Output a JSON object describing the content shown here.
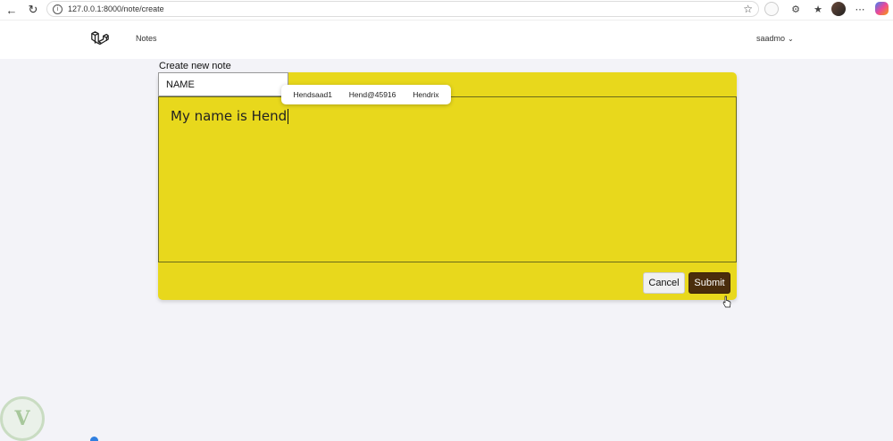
{
  "browser": {
    "url": "127.0.0.1:8000/note/create",
    "back_icon": "back-arrow-icon",
    "reload_icon": "reload-icon",
    "info_icon": "info-icon",
    "star_icon": "star-icon"
  },
  "header": {
    "nav_notes": "Notes",
    "user_name": "saadmo"
  },
  "form": {
    "title": "Create new note",
    "name_value": "NAME",
    "body_value": "My name is Hend",
    "cancel_label": "Cancel",
    "submit_label": "Submit"
  },
  "autocomplete": {
    "options": [
      "Hendsaad1",
      "Hend@45916",
      "Hendrix"
    ]
  },
  "colors": {
    "note_yellow": "#e8d81c",
    "submit_brown": "#4a2d0c",
    "page_bg": "#f3f3f8"
  }
}
